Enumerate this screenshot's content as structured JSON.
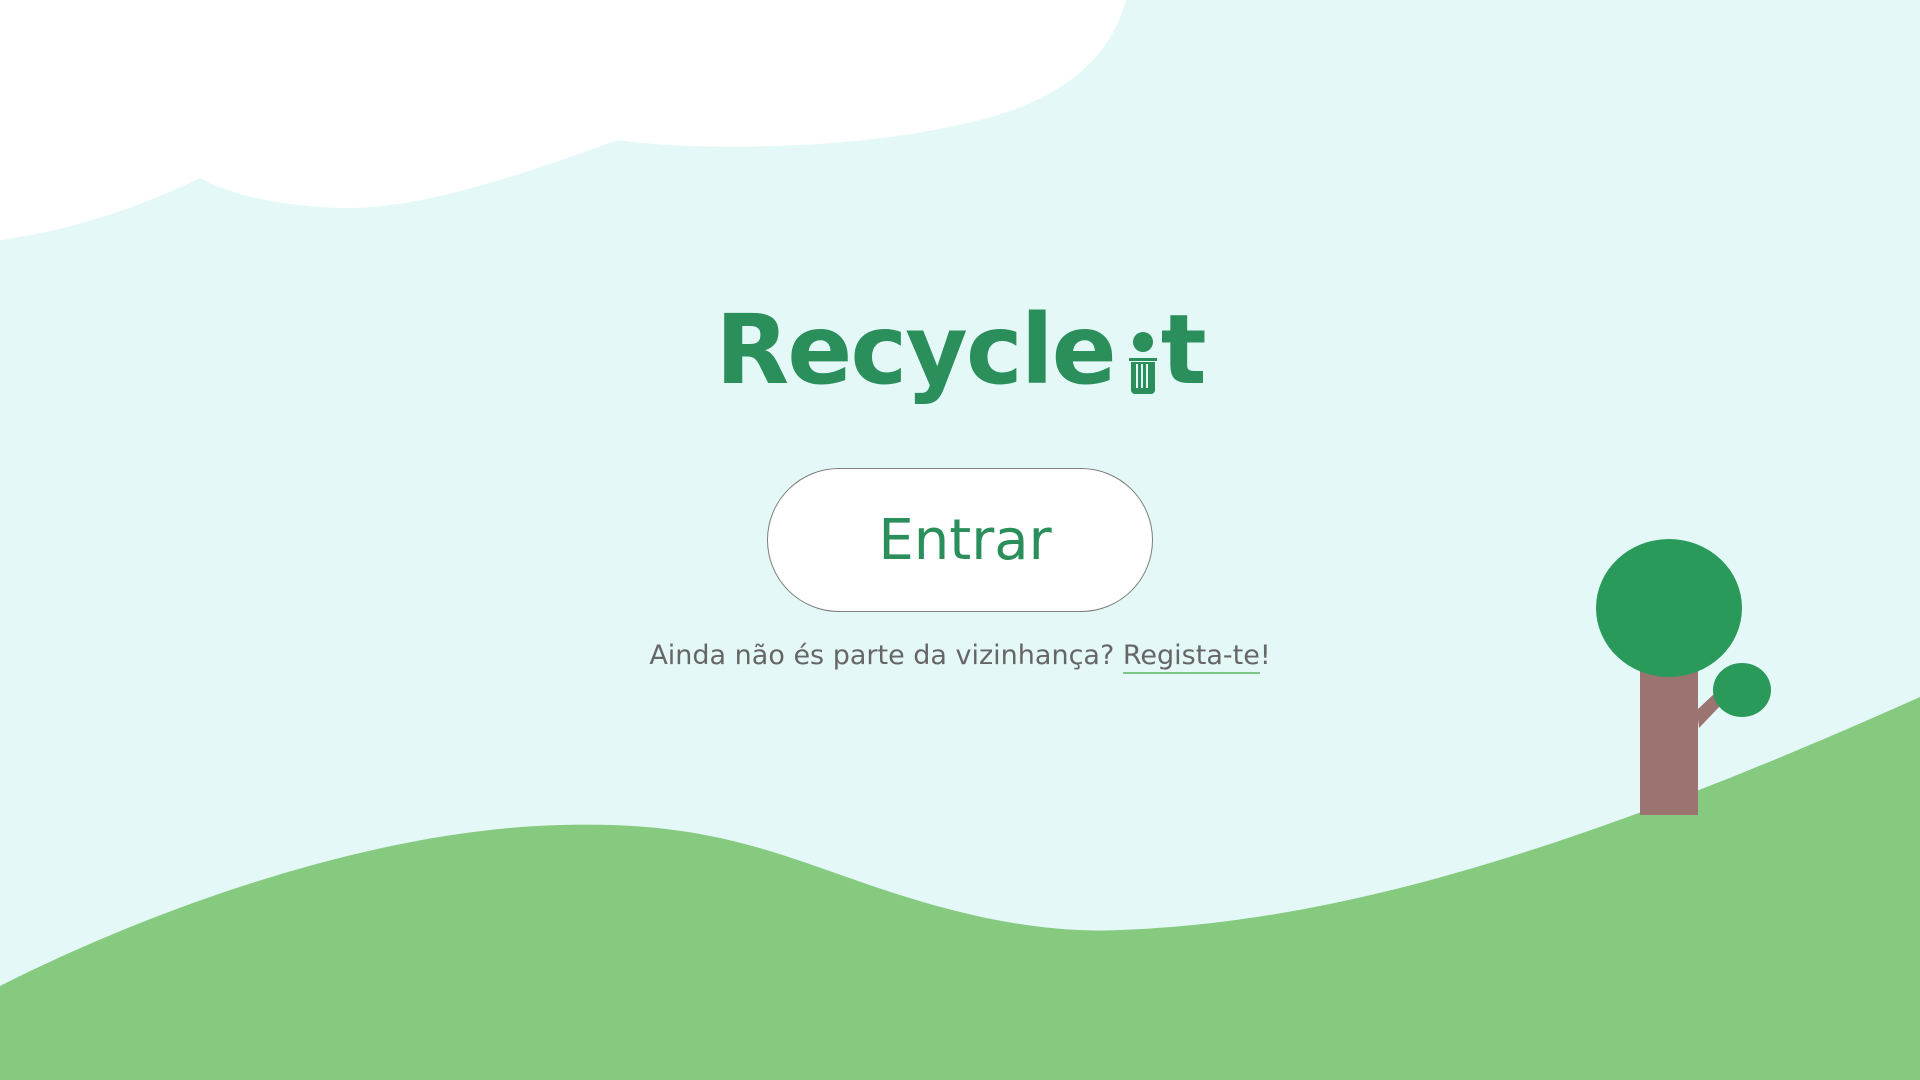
{
  "app": {
    "logo_word": "Recycle",
    "logo_suffix": "t"
  },
  "login": {
    "enter_label": "Entrar"
  },
  "signup": {
    "prompt": "Ainda não és parte da vizinhança? ",
    "link_label": "Regista-te",
    "suffix": "!"
  },
  "colors": {
    "sky": "#e4f8f8",
    "cloud": "#ffffff",
    "grass": "#86ca80",
    "brand_green": "#2a8f5a",
    "tree_foliage": "#2a9a5a",
    "tree_trunk": "#9b7371",
    "muted_text": "#666666"
  },
  "icons": {
    "logo_i": "trash-bin-icon"
  }
}
